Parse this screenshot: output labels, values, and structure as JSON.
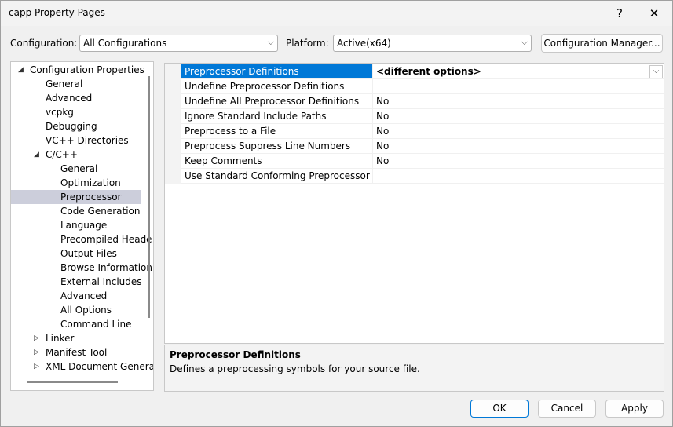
{
  "window": {
    "title": "capp Property Pages",
    "help_label": "?",
    "close_label": "✕"
  },
  "toolbar": {
    "configuration_label": "Configuration:",
    "configuration_value": "All Configurations",
    "platform_label": "Platform:",
    "platform_value": "Active(x64)",
    "config_manager_label": "Configuration Manager..."
  },
  "tree": {
    "nodes": [
      {
        "label": "Configuration Properties",
        "level": 0,
        "expander": "expanded"
      },
      {
        "label": "General",
        "level": 1
      },
      {
        "label": "Advanced",
        "level": 1
      },
      {
        "label": "vcpkg",
        "level": 1
      },
      {
        "label": "Debugging",
        "level": 1
      },
      {
        "label": "VC++ Directories",
        "level": 1
      },
      {
        "label": "C/C++",
        "level": 1,
        "expander": "expanded"
      },
      {
        "label": "General",
        "level": 2
      },
      {
        "label": "Optimization",
        "level": 2
      },
      {
        "label": "Preprocessor",
        "level": 2,
        "selected": true
      },
      {
        "label": "Code Generation",
        "level": 2
      },
      {
        "label": "Language",
        "level": 2
      },
      {
        "label": "Precompiled Heade",
        "level": 2
      },
      {
        "label": "Output Files",
        "level": 2
      },
      {
        "label": "Browse Information",
        "level": 2
      },
      {
        "label": "External Includes",
        "level": 2
      },
      {
        "label": "Advanced",
        "level": 2
      },
      {
        "label": "All Options",
        "level": 2
      },
      {
        "label": "Command Line",
        "level": 2
      },
      {
        "label": "Linker",
        "level": 1,
        "expander": "collapsed"
      },
      {
        "label": "Manifest Tool",
        "level": 1,
        "expander": "collapsed"
      },
      {
        "label": "XML Document Genera",
        "level": 1,
        "expander": "collapsed"
      }
    ]
  },
  "properties": [
    {
      "name": "Preprocessor Definitions",
      "value": "<different options>",
      "selected": true
    },
    {
      "name": "Undefine Preprocessor Definitions",
      "value": ""
    },
    {
      "name": "Undefine All Preprocessor Definitions",
      "value": "No"
    },
    {
      "name": "Ignore Standard Include Paths",
      "value": "No"
    },
    {
      "name": "Preprocess to a File",
      "value": "No"
    },
    {
      "name": "Preprocess Suppress Line Numbers",
      "value": "No"
    },
    {
      "name": "Keep Comments",
      "value": "No"
    },
    {
      "name": "Use Standard Conforming Preprocessor",
      "value": ""
    }
  ],
  "description": {
    "title": "Preprocessor Definitions",
    "text": "Defines a preprocessing symbols for your source file."
  },
  "buttons": {
    "ok": "OK",
    "cancel": "Cancel",
    "apply": "Apply"
  },
  "colors": {
    "selection_accent": "#0078d7",
    "tree_selection": "#cccedb",
    "ok_border": "#0078d7"
  }
}
